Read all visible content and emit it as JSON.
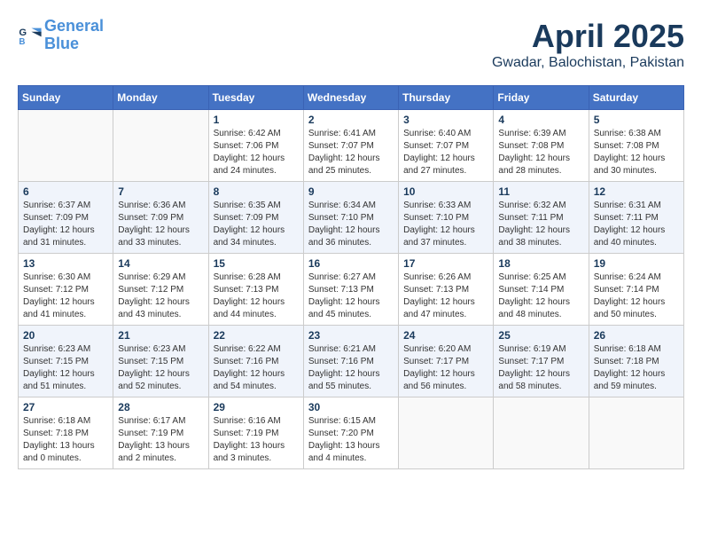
{
  "header": {
    "logo_line1": "General",
    "logo_line2": "Blue",
    "month": "April 2025",
    "location": "Gwadar, Balochistan, Pakistan"
  },
  "weekdays": [
    "Sunday",
    "Monday",
    "Tuesday",
    "Wednesday",
    "Thursday",
    "Friday",
    "Saturday"
  ],
  "weeks": [
    [
      {
        "day": "",
        "sunrise": "",
        "sunset": "",
        "daylight": ""
      },
      {
        "day": "",
        "sunrise": "",
        "sunset": "",
        "daylight": ""
      },
      {
        "day": "1",
        "sunrise": "Sunrise: 6:42 AM",
        "sunset": "Sunset: 7:06 PM",
        "daylight": "Daylight: 12 hours and 24 minutes."
      },
      {
        "day": "2",
        "sunrise": "Sunrise: 6:41 AM",
        "sunset": "Sunset: 7:07 PM",
        "daylight": "Daylight: 12 hours and 25 minutes."
      },
      {
        "day": "3",
        "sunrise": "Sunrise: 6:40 AM",
        "sunset": "Sunset: 7:07 PM",
        "daylight": "Daylight: 12 hours and 27 minutes."
      },
      {
        "day": "4",
        "sunrise": "Sunrise: 6:39 AM",
        "sunset": "Sunset: 7:08 PM",
        "daylight": "Daylight: 12 hours and 28 minutes."
      },
      {
        "day": "5",
        "sunrise": "Sunrise: 6:38 AM",
        "sunset": "Sunset: 7:08 PM",
        "daylight": "Daylight: 12 hours and 30 minutes."
      }
    ],
    [
      {
        "day": "6",
        "sunrise": "Sunrise: 6:37 AM",
        "sunset": "Sunset: 7:09 PM",
        "daylight": "Daylight: 12 hours and 31 minutes."
      },
      {
        "day": "7",
        "sunrise": "Sunrise: 6:36 AM",
        "sunset": "Sunset: 7:09 PM",
        "daylight": "Daylight: 12 hours and 33 minutes."
      },
      {
        "day": "8",
        "sunrise": "Sunrise: 6:35 AM",
        "sunset": "Sunset: 7:09 PM",
        "daylight": "Daylight: 12 hours and 34 minutes."
      },
      {
        "day": "9",
        "sunrise": "Sunrise: 6:34 AM",
        "sunset": "Sunset: 7:10 PM",
        "daylight": "Daylight: 12 hours and 36 minutes."
      },
      {
        "day": "10",
        "sunrise": "Sunrise: 6:33 AM",
        "sunset": "Sunset: 7:10 PM",
        "daylight": "Daylight: 12 hours and 37 minutes."
      },
      {
        "day": "11",
        "sunrise": "Sunrise: 6:32 AM",
        "sunset": "Sunset: 7:11 PM",
        "daylight": "Daylight: 12 hours and 38 minutes."
      },
      {
        "day": "12",
        "sunrise": "Sunrise: 6:31 AM",
        "sunset": "Sunset: 7:11 PM",
        "daylight": "Daylight: 12 hours and 40 minutes."
      }
    ],
    [
      {
        "day": "13",
        "sunrise": "Sunrise: 6:30 AM",
        "sunset": "Sunset: 7:12 PM",
        "daylight": "Daylight: 12 hours and 41 minutes."
      },
      {
        "day": "14",
        "sunrise": "Sunrise: 6:29 AM",
        "sunset": "Sunset: 7:12 PM",
        "daylight": "Daylight: 12 hours and 43 minutes."
      },
      {
        "day": "15",
        "sunrise": "Sunrise: 6:28 AM",
        "sunset": "Sunset: 7:13 PM",
        "daylight": "Daylight: 12 hours and 44 minutes."
      },
      {
        "day": "16",
        "sunrise": "Sunrise: 6:27 AM",
        "sunset": "Sunset: 7:13 PM",
        "daylight": "Daylight: 12 hours and 45 minutes."
      },
      {
        "day": "17",
        "sunrise": "Sunrise: 6:26 AM",
        "sunset": "Sunset: 7:13 PM",
        "daylight": "Daylight: 12 hours and 47 minutes."
      },
      {
        "day": "18",
        "sunrise": "Sunrise: 6:25 AM",
        "sunset": "Sunset: 7:14 PM",
        "daylight": "Daylight: 12 hours and 48 minutes."
      },
      {
        "day": "19",
        "sunrise": "Sunrise: 6:24 AM",
        "sunset": "Sunset: 7:14 PM",
        "daylight": "Daylight: 12 hours and 50 minutes."
      }
    ],
    [
      {
        "day": "20",
        "sunrise": "Sunrise: 6:23 AM",
        "sunset": "Sunset: 7:15 PM",
        "daylight": "Daylight: 12 hours and 51 minutes."
      },
      {
        "day": "21",
        "sunrise": "Sunrise: 6:23 AM",
        "sunset": "Sunset: 7:15 PM",
        "daylight": "Daylight: 12 hours and 52 minutes."
      },
      {
        "day": "22",
        "sunrise": "Sunrise: 6:22 AM",
        "sunset": "Sunset: 7:16 PM",
        "daylight": "Daylight: 12 hours and 54 minutes."
      },
      {
        "day": "23",
        "sunrise": "Sunrise: 6:21 AM",
        "sunset": "Sunset: 7:16 PM",
        "daylight": "Daylight: 12 hours and 55 minutes."
      },
      {
        "day": "24",
        "sunrise": "Sunrise: 6:20 AM",
        "sunset": "Sunset: 7:17 PM",
        "daylight": "Daylight: 12 hours and 56 minutes."
      },
      {
        "day": "25",
        "sunrise": "Sunrise: 6:19 AM",
        "sunset": "Sunset: 7:17 PM",
        "daylight": "Daylight: 12 hours and 58 minutes."
      },
      {
        "day": "26",
        "sunrise": "Sunrise: 6:18 AM",
        "sunset": "Sunset: 7:18 PM",
        "daylight": "Daylight: 12 hours and 59 minutes."
      }
    ],
    [
      {
        "day": "27",
        "sunrise": "Sunrise: 6:18 AM",
        "sunset": "Sunset: 7:18 PM",
        "daylight": "Daylight: 13 hours and 0 minutes."
      },
      {
        "day": "28",
        "sunrise": "Sunrise: 6:17 AM",
        "sunset": "Sunset: 7:19 PM",
        "daylight": "Daylight: 13 hours and 2 minutes."
      },
      {
        "day": "29",
        "sunrise": "Sunrise: 6:16 AM",
        "sunset": "Sunset: 7:19 PM",
        "daylight": "Daylight: 13 hours and 3 minutes."
      },
      {
        "day": "30",
        "sunrise": "Sunrise: 6:15 AM",
        "sunset": "Sunset: 7:20 PM",
        "daylight": "Daylight: 13 hours and 4 minutes."
      },
      {
        "day": "",
        "sunrise": "",
        "sunset": "",
        "daylight": ""
      },
      {
        "day": "",
        "sunrise": "",
        "sunset": "",
        "daylight": ""
      },
      {
        "day": "",
        "sunrise": "",
        "sunset": "",
        "daylight": ""
      }
    ]
  ]
}
